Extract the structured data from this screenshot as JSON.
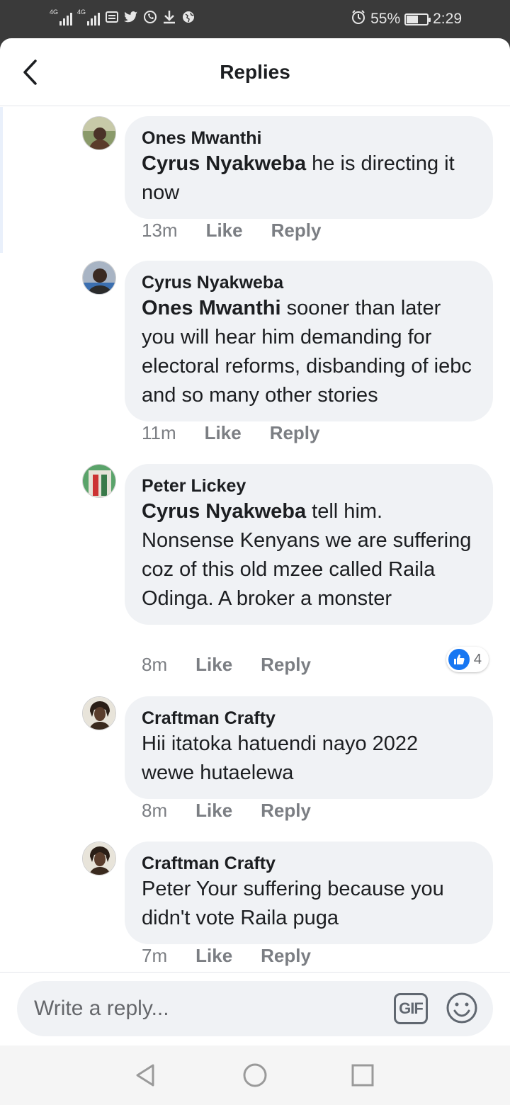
{
  "status_bar": {
    "network_1": "4G",
    "network_2": "4G",
    "battery_percent": "55%",
    "battery_level": 0.55,
    "time": "2:29"
  },
  "header": {
    "title": "Replies"
  },
  "comments": [
    {
      "author": "Ones Mwanthi",
      "mention": "Cyrus Nyakweba",
      "text": " he is directing it now",
      "time": "13m",
      "like_label": "Like",
      "reply_label": "Reply"
    },
    {
      "author": "Cyrus Nyakweba",
      "mention": "Ones Mwanthi",
      "text": " sooner than later you will hear him demanding for electoral reforms, disbanding of iebc and so many other stories",
      "time": "11m",
      "like_label": "Like",
      "reply_label": "Reply"
    },
    {
      "author": "Peter Lickey",
      "mention": "Cyrus Nyakweba",
      "text": " tell him. Nonsense Kenyans we are suffering coz of this old mzee called Raila Odinga. A broker a monster",
      "time": "8m",
      "like_label": "Like",
      "reply_label": "Reply",
      "reaction_count": "4"
    },
    {
      "author": "Craftman Crafty",
      "mention": "",
      "text": "Hii itatoka hatuendi nayo 2022 wewe hutaelewa",
      "time": "8m",
      "like_label": "Like",
      "reply_label": "Reply"
    },
    {
      "author": "Craftman Crafty",
      "mention": "",
      "text": "Peter Your suffering because you didn't vote Raila puga",
      "time": "7m",
      "like_label": "Like",
      "reply_label": "Reply"
    }
  ],
  "composer": {
    "placeholder": "Write a reply...",
    "gif_label": "GIF"
  },
  "colors": {
    "bubble": "#f0f2f5",
    "like_blue": "#1877f2",
    "meta_gray": "#7b7e83"
  },
  "icons": [
    "back-arrow-icon",
    "gif-icon",
    "emoji-icon",
    "nav-back-icon",
    "nav-home-icon",
    "nav-recents-icon"
  ]
}
